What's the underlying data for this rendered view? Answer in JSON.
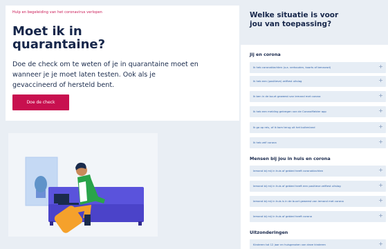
{
  "hero": {
    "breadcrumb": "Hulp en begeleiding van het coronavirus verlopen",
    "title": "Moet ik in quarantaine?",
    "description": "Doe de check om te weten of je in quarantaine moet en wanneer je je moet laten testen. Ook als je gevaccineerd of hersteld bent.",
    "cta_label": "Doe de check"
  },
  "panel": {
    "title": "Welke situatie is voor jou van toepassing?",
    "sections": [
      {
        "heading": "Jij en corona",
        "items": [
          "Ik heb coronaklachten (o.a. verkouden, koorts of benauwd)",
          "Ik heb een (positieve) zelftest uitslag",
          "Ik ben in de buurt geweest van iemand met corona",
          "Ik heb een melding gekregen van de CoronaMelder app",
          "Ik ga op reis, of ik kom terug uit het buitenland",
          "Ik heb zelf corona"
        ]
      },
      {
        "heading": "Mensen bij jou in huis en corona",
        "items": [
          "Iemand bij mij in huis of gebied heeft coronaklachten",
          "Iemand bij mij in huis of gebied heeft een positieve zelftest uitslag",
          "Iemand bij mij in huis is in de buurt geweest van iemand met corona",
          "Iemand bij mij in huis of gebied heeft corona"
        ]
      },
      {
        "heading": "Uitzonderingen",
        "items": [
          "Kinderen tot 12 jaar en huisgenoten van deze kinderen"
        ]
      }
    ],
    "expand_symbol": "+"
  },
  "colors": {
    "brand": "#c8104f",
    "title": "#16264a",
    "accordion_bg": "#e6edf5",
    "accordion_text": "#2b5fa8",
    "page_bg": "#e9eef4",
    "sofa": "#5a53dc",
    "jacket": "#2aa44a",
    "trousers": "#f5a12b"
  }
}
